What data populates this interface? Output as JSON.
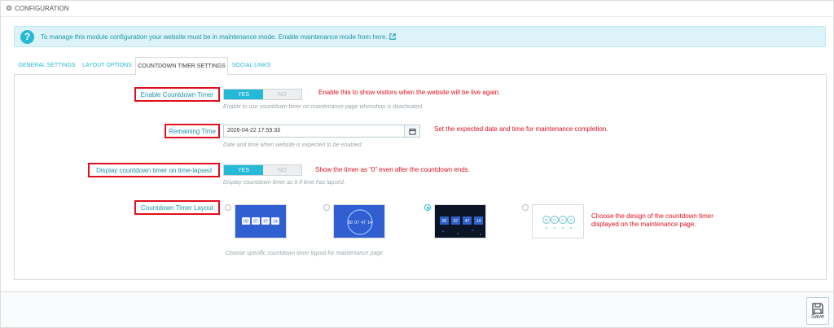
{
  "panel": {
    "title": "CONFIGURATION",
    "icon": "gear-icon"
  },
  "alert": {
    "icon": "question-icon",
    "text": "To manage this module configuration your website must be in maintenance mode. Enable maintenance mode from ",
    "link_text": "here.",
    "link_icon": "external-link-icon"
  },
  "tabs": [
    {
      "label": "GENERAL SETTINGS",
      "active": false
    },
    {
      "label": "LAYOUT OPTIONS",
      "active": false
    },
    {
      "label": "COUNTDOWN TIMER SETTINGS",
      "active": true
    },
    {
      "label": "SOCIAL LINKS",
      "active": false
    }
  ],
  "enable_timer": {
    "label": "Enable Countdown Timer",
    "yes": "YES",
    "no": "NO",
    "value": "YES",
    "help": "Enable to use countdown timer on maintenance page whenshop is deactivated.",
    "note": "Enable this to show visitors when the website will be live again."
  },
  "remaining_time": {
    "label": "Remaining Time",
    "value": "2026-04-22 17:59:33",
    "icon": "calendar-icon",
    "help": "Date and time when website is expected to be enabled.",
    "note": "Set the expected date and time for maintenance completion."
  },
  "display_lapsed": {
    "label": "Display countdown timer on time-lapsed",
    "yes": "YES",
    "no": "NO",
    "value": "YES",
    "help": "Display countdown timer as 0 if time has lapsed.",
    "note": "Show the timer as “0” even after the countdown ends."
  },
  "layout": {
    "label": "Countdown Timer Layout",
    "selected_index": 2,
    "options": [
      {
        "name": "blue-boxes",
        "digits": [
          "00",
          "07",
          "47",
          "14"
        ]
      },
      {
        "name": "blue-circle",
        "digits": [
          "00",
          "07",
          "47",
          "14"
        ]
      },
      {
        "name": "dark-boxes",
        "digits": [
          "00",
          "07",
          "47",
          "14"
        ]
      },
      {
        "name": "light-circles",
        "digits": [
          "00",
          "07",
          "47",
          "14"
        ]
      }
    ],
    "help": "Choose specific countdown timer layout for maintenance page.",
    "note_line1": "Choose the design of the countdown timer",
    "note_line2": "displayed on the maintenance page."
  },
  "footer": {
    "save_label": "Save",
    "save_icon": "floppy-disk-icon"
  },
  "colors": {
    "accent": "#25b9d7",
    "annotation": "#e0101e",
    "help_text": "#9aa5ab"
  }
}
